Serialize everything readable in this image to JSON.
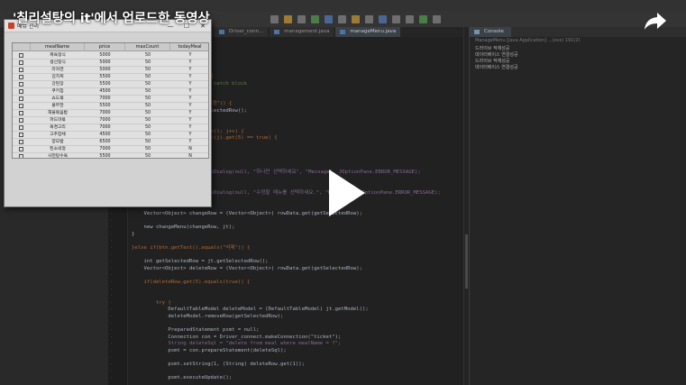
{
  "video": {
    "title": "'칠리설탕의 it'에서 업로드한 동영상",
    "share_icon": "share-arrow-icon",
    "play_icon": "play-triangle-icon",
    "overlay_color": "#ffffff"
  },
  "ide": {
    "editor_tabs": [
      "Driver_conn...",
      "management.java",
      "manageMenu.java"
    ],
    "console": {
      "tab_label": "Console",
      "path": "ManageMenu [Java Application] ...(xxx) 191(2)",
      "lines": [
        "드라이브 적재성공",
        "데이터베이스 연결성공",
        "드라이브 적재성공",
        "데이터베이스 연결성공"
      ]
    },
    "code_lines": [
      {
        "text": "this.add(v);",
        "cls": ""
      },
      {
        "text": "",
        "cls": ""
      },
      {
        "text": "setList();",
        "cls": "fn"
      },
      {
        "text": "repaint();",
        "cls": "fn"
      },
      {
        "text": "",
        "cls": ""
      },
      {
        "text": "} catch (SQLException e1) {",
        "cls": "kw"
      },
      {
        "text": "    // TODO Auto-generated catch block",
        "cls": "cm"
      },
      {
        "text": "    e1.printStackTrace();",
        "cls": "fn"
      },
      {
        "text": "}",
        "cls": ""
      },
      {
        "text": "if(btn.getText().equals(\"수정\")) {",
        "cls": "kw"
      },
      {
        "text": "    selectedRow = jt.getSelectedRow();",
        "cls": "fn"
      },
      {
        "text": "",
        "cls": ""
      },
      {
        "text": "",
        "cls": ""
      },
      {
        "text": "for(int j=0; j<rowData.size(); j++) {",
        "cls": "kw"
      },
      {
        "text": "    if((boolean)rowData.get(j).get(5) == true) {",
        "cls": "kw"
      },
      {
        "text": "        count++;",
        "cls": "fn"
      },
      {
        "text": "    }",
        "cls": ""
      },
      {
        "text": "}",
        "cls": ""
      },
      {
        "text": "if(count > 1) {",
        "cls": "kw"
      },
      {
        "text": "    JOptionPane.showMessageDialog(null, \"하나만 선택하세요\", \"Message\", JOptionPane.ERROR_MESSAGE);",
        "cls": "st"
      },
      {
        "text": "}",
        "cls": ""
      },
      {
        "text": "else if(count == 0) {",
        "cls": "kw"
      },
      {
        "text": "    JOptionPane.showMessageDialog(null, \"수정할 메뉴를 선택하세요.\", \"Message\", JOptionPane.ERROR_MESSAGE);",
        "cls": "st"
      },
      {
        "text": "}else {",
        "cls": "kw"
      },
      {
        "text": "",
        "cls": ""
      },
      {
        "text": "    Vector<Object> changeRow = (Vector<Object>) rowData.get(getSelectedRow);",
        "cls": "fn"
      },
      {
        "text": "",
        "cls": ""
      },
      {
        "text": "    new changeMenu(changeRow, jt);",
        "cls": "fn"
      },
      {
        "text": "}",
        "cls": ""
      },
      {
        "text": "",
        "cls": ""
      },
      {
        "text": "}else if(btn.getText().equals(\"삭제\")) {",
        "cls": "kw"
      },
      {
        "text": "",
        "cls": ""
      },
      {
        "text": "    int getSelectedRow = jt.getSelectedRow();",
        "cls": "fn"
      },
      {
        "text": "    Vector<Object> deleteRow = (Vector<Object>) rowData.get(getSelectedRow);",
        "cls": "fn"
      },
      {
        "text": "",
        "cls": ""
      },
      {
        "text": "    if(deleteRow.get(5).equals(true)) {",
        "cls": "kw"
      },
      {
        "text": "",
        "cls": ""
      },
      {
        "text": "",
        "cls": ""
      },
      {
        "text": "        try {",
        "cls": "kw"
      },
      {
        "text": "            DefaultTableModel deleteModel = (DefaultTableModel) jt.getModel();",
        "cls": "fn"
      },
      {
        "text": "            deleteModel.removeRow(getSelectedRow);",
        "cls": "fn"
      },
      {
        "text": "",
        "cls": ""
      },
      {
        "text": "            PreparedStatement psmt = null;",
        "cls": "fn"
      },
      {
        "text": "            Connection con = Driver_connect.makeConnection(\"ticket\");",
        "cls": "fn"
      },
      {
        "text": "            String deleteSql = \"delete from meal where mealName = ?\";",
        "cls": "st"
      },
      {
        "text": "            psmt = con.prepareStatement(deleteSql);",
        "cls": "fn"
      },
      {
        "text": "",
        "cls": ""
      },
      {
        "text": "            psmt.setString(1, (String) deleteRow.get(1));",
        "cls": "fn"
      },
      {
        "text": "",
        "cls": ""
      },
      {
        "text": "            psmt.executeUpdate();",
        "cls": "fn"
      }
    ]
  },
  "swing_window": {
    "title": "메뉴 관리",
    "controls": {
      "minimize": "—",
      "maximize": "☐",
      "close": "✕"
    },
    "columns": [
      "",
      "mealName",
      "price",
      "maxCount",
      "todayMeal"
    ],
    "rows": [
      [
        "",
        "제육정식",
        "5000",
        "50",
        "Y"
      ],
      [
        "",
        "생선정식",
        "5000",
        "50",
        "Y"
      ],
      [
        "",
        "라자면",
        "5000",
        "50",
        "Y"
      ],
      [
        "",
        "김치찌",
        "5500",
        "50",
        "Y"
      ],
      [
        "",
        "강된장",
        "5500",
        "50",
        "Y"
      ],
      [
        "",
        "쿠키칩",
        "4500",
        "50",
        "Y"
      ],
      [
        "",
        "쇼드볶",
        "7000",
        "50",
        "Y"
      ],
      [
        "",
        "볼무한",
        "5500",
        "50",
        "Y"
      ],
      [
        "",
        "해물볶음밥",
        "7000",
        "50",
        "Y"
      ],
      [
        "",
        "파드마볶",
        "7000",
        "50",
        "Y"
      ],
      [
        "",
        "복경고리",
        "7000",
        "50",
        "Y"
      ],
      [
        "",
        "고추잡채",
        "4500",
        "50",
        "Y"
      ],
      [
        "",
        "양모밥",
        "6500",
        "50",
        "Y"
      ],
      [
        "",
        "된소네정",
        "7000",
        "50",
        "N"
      ],
      [
        "",
        "사천탕수육",
        "5500",
        "50",
        "N"
      ]
    ]
  }
}
